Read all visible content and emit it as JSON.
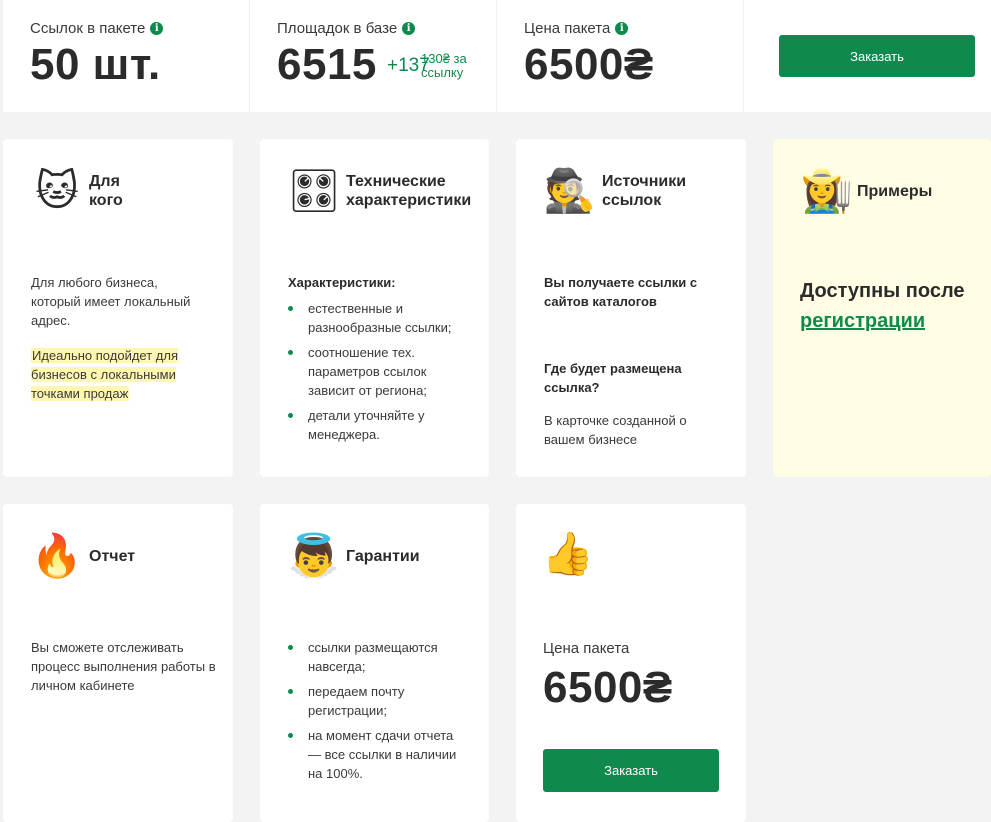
{
  "stats": {
    "links": {
      "label": "Ссылок в пакете",
      "value": "50 шт."
    },
    "sites": {
      "label": "Площадок в базе",
      "value": "6515",
      "delta": "+137"
    },
    "price": {
      "label": "Цена пакета",
      "value": "6500₴",
      "sub": "130₴ за ссылку"
    },
    "order_label": "Заказать"
  },
  "cards": {
    "who": {
      "icon": "cat-face-icon",
      "emoji": "🐱",
      "title": "Для кого",
      "text": "Для любого бизнеса, который имеет локальный адрес.",
      "highlight": "Идеально подойдет для бизнесов с локальными точками продаж"
    },
    "tech": {
      "icon": "control-knobs-icon",
      "emoji": "🎛",
      "title": "Технические характеристики",
      "heading": "Характеристики:",
      "items": [
        "естественные и разнообразные ссылки;",
        "соотношение тех. параметров ссылок зависит от региона;",
        "детали уточняйте у менеджера."
      ]
    },
    "sources": {
      "icon": "detective-icon",
      "emoji": "🕵",
      "title": "Источники ссылок",
      "text1": "Вы получаете ссылки с сайтов каталогов",
      "question": "Где будет размещена ссылка?",
      "answer": "В карточке созданной о вашем бизнесе"
    },
    "examples": {
      "icon": "farmer-icon",
      "emoji": "👩‍🌾",
      "title": "Примеры",
      "text": "Доступны после",
      "link": "регистрации"
    },
    "report": {
      "icon": "fire-icon",
      "emoji": "🔥",
      "title": "Отчет",
      "text": "Вы сможете отслеживать процесс выполнения работы в личном кабинете"
    },
    "guarantee": {
      "icon": "angel-baby-icon",
      "emoji": "👼",
      "title": "Гарантии",
      "items": [
        "ссылки размещаются навсегда;",
        "передаем почту регистрации;",
        "на момент сдачи отчета — все ссылки в наличии на 100%."
      ]
    },
    "order": {
      "icon": "thumbs-up-icon",
      "emoji": "👍",
      "price_label": "Цена пакета",
      "price": "6500₴",
      "button": "Заказать"
    }
  },
  "colors": {
    "accent": "#0e8a4f",
    "highlight": "#fff7b0",
    "examples_bg": "#fffde3"
  }
}
